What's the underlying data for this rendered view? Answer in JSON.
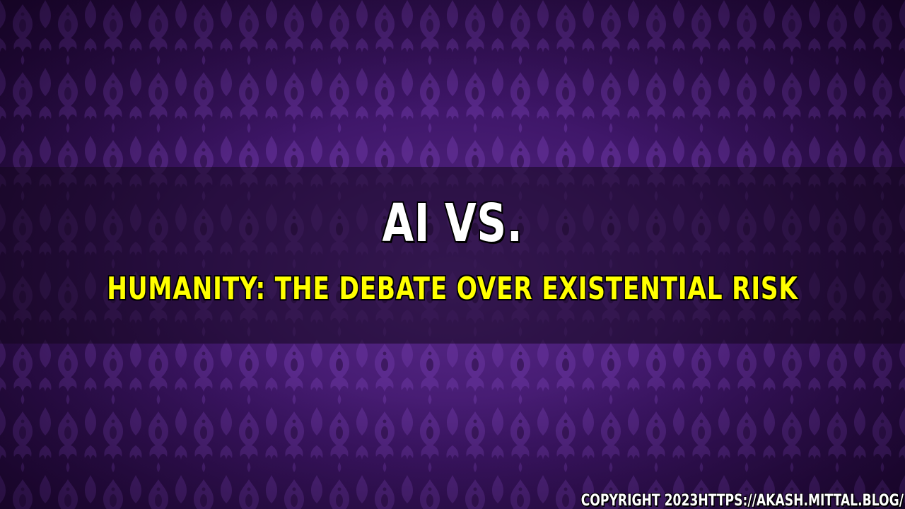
{
  "title": {
    "line1": "AI VS.",
    "line2": "HUMANITY: THE DEBATE OVER EXISTENTIAL RISK"
  },
  "footer": {
    "copyright": "COPYRIGHT 2023HTTPS://AKASH.MITTAL.BLOG/"
  },
  "colors": {
    "background_purple": "#3e1668",
    "pattern_light": "#6a34a0",
    "band_dark": "#140820",
    "title_white": "#ffffff",
    "subtitle_yellow": "#ffff00",
    "outline_black": "#000000"
  }
}
